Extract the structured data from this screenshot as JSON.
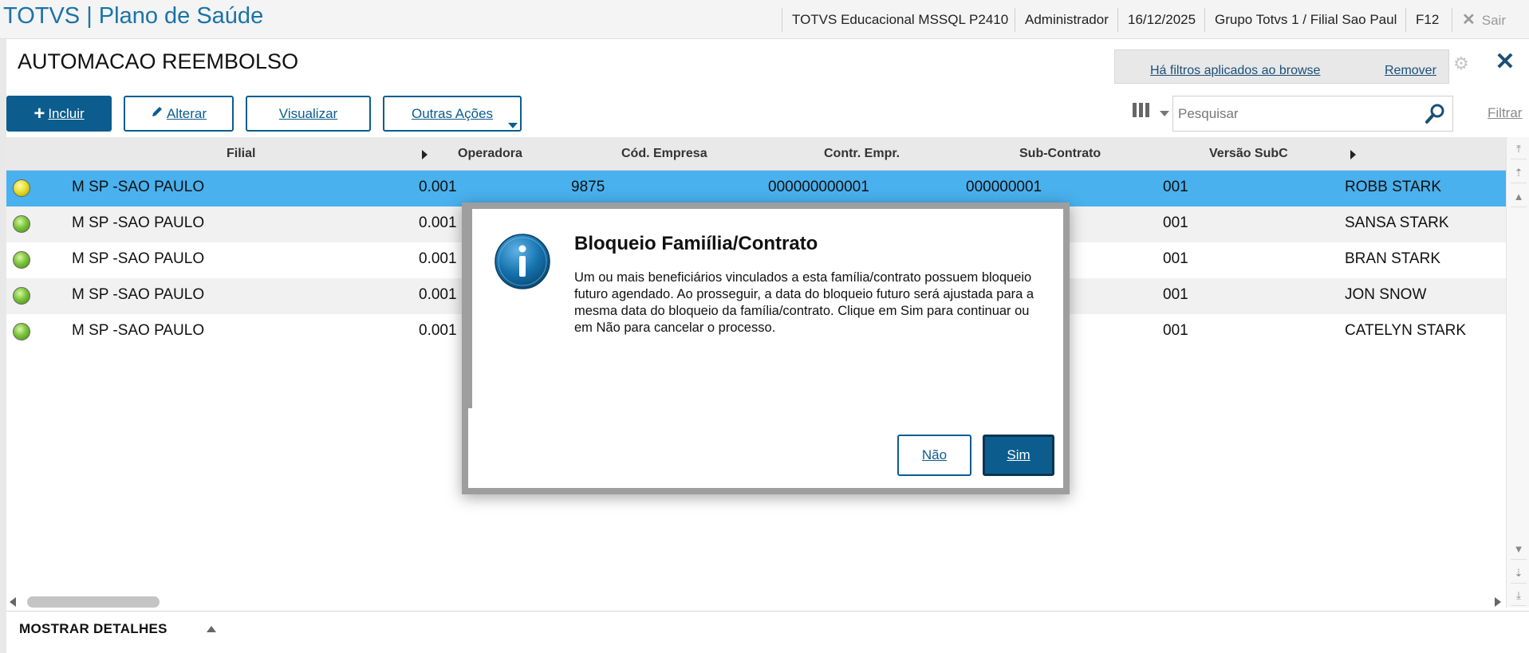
{
  "header": {
    "app_title": "TOTVS | Plano de Saúde",
    "environment": "TOTVS Educacional MSSQL P2410",
    "user": "Administrador",
    "date": "16/12/2025",
    "branch": "Grupo Totvs 1 / Filial Sao Paul",
    "shortcut": "F12",
    "exit_label": "Sair"
  },
  "page": {
    "title": "AUTOMACAO REEMBOLSO",
    "filter_notice": "Há filtros aplicados ao browse",
    "filter_remove": "Remover"
  },
  "toolbar": {
    "include": "Incluir",
    "edit": "Alterar",
    "view": "Visualizar",
    "other_actions": "Outras Ações",
    "search_placeholder": "Pesquisar",
    "filter": "Filtrar"
  },
  "grid": {
    "columns": [
      "Filial",
      "Operadora",
      "Cód. Empresa",
      "Contr. Empr.",
      "Sub-Contrato",
      "Versão SubC"
    ],
    "rows": [
      {
        "status": "yellow",
        "filial": "M SP -SAO PAULO",
        "operadora": "0.001",
        "cod_empresa": "9875",
        "contr_empr": "000000000001",
        "sub_contrato": "000000001",
        "versao": "001",
        "nome": "ROBB STARK"
      },
      {
        "status": "green",
        "filial": "M SP -SAO PAULO",
        "operadora": "0.001",
        "cod_empresa": "",
        "contr_empr": "",
        "sub_contrato": "",
        "versao": "001",
        "nome": "SANSA STARK"
      },
      {
        "status": "green",
        "filial": "M SP -SAO PAULO",
        "operadora": "0.001",
        "cod_empresa": "",
        "contr_empr": "",
        "sub_contrato": "",
        "versao": "001",
        "nome": "BRAN STARK"
      },
      {
        "status": "green",
        "filial": "M SP -SAO PAULO",
        "operadora": "0.001",
        "cod_empresa": "",
        "contr_empr": "",
        "sub_contrato": "",
        "versao": "001",
        "nome": "JON SNOW"
      },
      {
        "status": "green",
        "filial": "M SP -SAO PAULO",
        "operadora": "0.001",
        "cod_empresa": "",
        "contr_empr": "",
        "sub_contrato": "",
        "versao": "001",
        "nome": "CATELYN STARK"
      }
    ]
  },
  "details": {
    "label": "MOSTRAR DETALHES"
  },
  "dialog": {
    "title": "Bloqueio Famiília/Contrato",
    "message": "Um ou mais beneficiários vinculados a esta família/contrato possuem bloqueio futuro agendado. Ao prosseguir, a data do bloqueio futuro será ajustada para a mesma data do bloqueio da família/contrato. Clique em Sim para continuar ou em Não para cancelar o processo.",
    "no_label": "Não",
    "yes_label": "Sim"
  },
  "colors": {
    "brand": "#1b73a7",
    "primary_button": "#0c5d8e",
    "selected_row": "#49b1ee"
  }
}
